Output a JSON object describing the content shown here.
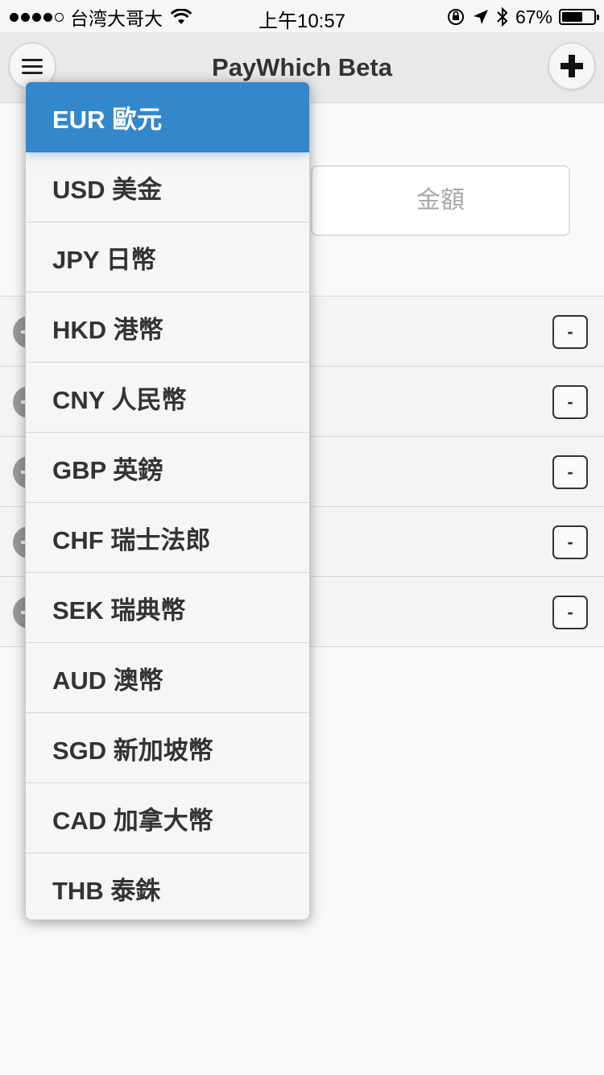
{
  "status_bar": {
    "carrier": "台湾大哥大",
    "time": "上午10:57",
    "battery": "67%",
    "battery_level": 0.67
  },
  "header": {
    "title": "PayWhich Beta",
    "menu_icon": "hamburger-icon",
    "add_icon": "plus-icon"
  },
  "amount": {
    "placeholder": "金額",
    "value": ""
  },
  "list": {
    "rows": [
      {
        "remove_label": "-"
      },
      {
        "remove_label": "-"
      },
      {
        "remove_label": "-"
      },
      {
        "remove_label": "-"
      },
      {
        "remove_label": "-"
      }
    ]
  },
  "dropdown": {
    "selected_index": 0,
    "items": [
      "EUR 歐元",
      "USD 美金",
      "JPY 日幣",
      "HKD 港幣",
      "CNY 人民幣",
      "GBP 英鎊",
      "CHF 瑞士法郎",
      "SEK 瑞典幣",
      "AUD 澳幣",
      "SGD 新加坡幣",
      "CAD 加拿大幣",
      "THB 泰銖"
    ]
  },
  "colors": {
    "accent": "#3388cc",
    "header_bg": "#e9e9e9",
    "page_bg": "#f9f9f9"
  }
}
